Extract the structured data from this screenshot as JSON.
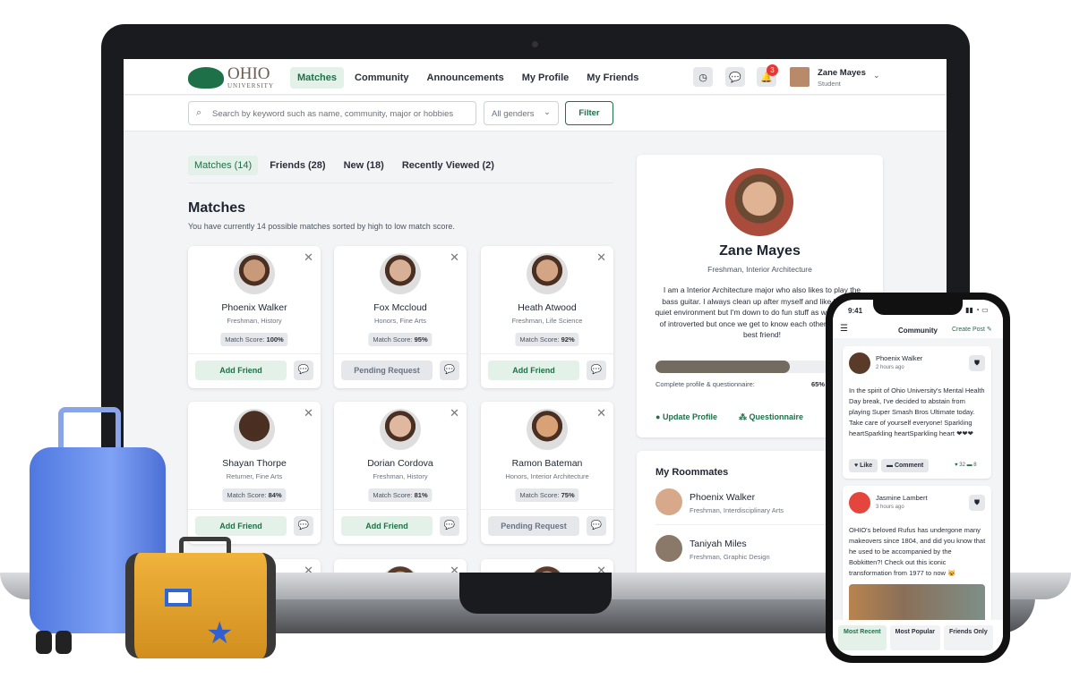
{
  "nav": {
    "logo_title": "OHIO",
    "logo_sub": "UNIVERSITY",
    "links": [
      "Matches",
      "Community",
      "Announcements",
      "My Profile",
      "My Friends"
    ],
    "notification_count": "3",
    "user_name": "Zane Mayes",
    "user_role": "Student"
  },
  "search": {
    "placeholder": "Search by keyword such as name, community, major or hobbies",
    "gender": "All genders",
    "filter": "Filter"
  },
  "tabs": [
    "Matches (14)",
    "Friends (28)",
    "New (18)",
    "Recently Viewed (2)"
  ],
  "matches": {
    "title": "Matches",
    "subtitle": "You have currently 14 possible matches sorted by high to low match score.",
    "score_label": "Match Score:",
    "cards": [
      {
        "name": "Phoenix Walker",
        "desc": "Freshman, History",
        "score": "100%",
        "action": "Add Friend"
      },
      {
        "name": "Fox Mccloud",
        "desc": "Honors, Fine Arts",
        "score": "95%",
        "action": "Pending Request"
      },
      {
        "name": "Heath Atwood",
        "desc": "Freshman, Life Science",
        "score": "92%",
        "action": "Add Friend"
      },
      {
        "name": "Shayan Thorpe",
        "desc": "Returner, Fine Arts",
        "score": "84%",
        "action": "Add Friend"
      },
      {
        "name": "Dorian Cordova",
        "desc": "Freshman, History",
        "score": "81%",
        "action": "Add Friend"
      },
      {
        "name": "Ramon Bateman",
        "desc": "Honors, Interior Architecture",
        "score": "75%",
        "action": "Pending Request"
      }
    ]
  },
  "profile": {
    "name": "Zane Mayes",
    "desc": "Freshman, Interior Architecture",
    "bio": "I am a Interior Architecture major who also likes to play the bass guitar. I always clean up after myself and like having a quiet environment but I'm down to do fun stuff as well! I am kind of introverted but once we get to know each other, I'll be your best friend!",
    "progress_label": "Complete profile & questionnaire:",
    "progress": "65%",
    "update": "Update Profile",
    "questionnaire": "Questionnaire"
  },
  "roommates": {
    "title": "My Roommates",
    "items": [
      {
        "name": "Phoenix Walker",
        "desc": "Freshman, Interdisciplinary Arts"
      },
      {
        "name": "Taniyah Miles",
        "desc": "Freshman, Graphic Design"
      }
    ]
  },
  "phone": {
    "time": "9:41",
    "title": "Community",
    "create": "Create Post",
    "posts": [
      {
        "name": "Phoenix Walker",
        "time": "2 hours ago",
        "text": "In the spirit of Ohio University's Mental Health Day break, I've decided to abstain from playing Super Smash Bros Ultimate today. Take care of yourself everyone! Sparkling heartSparkling heartSparkling heart ❤❤❤",
        "like": "Like",
        "comment": "Comment",
        "likes": "32",
        "comments": "8"
      },
      {
        "name": "Jasmine Lambert",
        "time": "3 hours ago",
        "text": "OHIO's beloved Rufus has undergone many makeovers since 1804, and did you know that he used to be accompanied by the Bobkitten?! Check out this iconic transformation from 1977 to now 😺"
      }
    ],
    "filters": [
      "Most Recent",
      "Most Popular",
      "Friends Only"
    ]
  },
  "colors": {
    "brand": "#1e7048",
    "progress": "#736a60"
  }
}
